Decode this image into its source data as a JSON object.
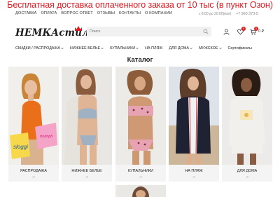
{
  "promo": {
    "text": "Бесплатная доставка оплаченного заказа от 10 тыс (в пункт Озон)"
  },
  "topbar": {
    "links": [
      "ДОСТАВКА",
      "ОПЛАТА",
      "ВОПРОС ОТВЕТ",
      "ОТЗЫВЫ",
      "КОНТАКТЫ",
      "О КОМПАНИИ"
    ],
    "hours": "с 8:00 до 20:00(мск)",
    "phone": "+7 960 373-5"
  },
  "header": {
    "logo_text": "НЕМКАстиль",
    "search_placeholder": "Поиск",
    "wishlist_count": "0",
    "cart_count": "0",
    "cart_sum": "0 ₽"
  },
  "mainnav": {
    "items": [
      "СКИДКИ / РАСПРОДАЖА",
      "НИЖНЕЕ БЕЛЬЕ",
      "КУПАЛЬНИКИ",
      "НА ПЛЯЖ",
      "ДЛЯ ДОМА",
      "МУЖСКОЕ",
      "Сертификаты"
    ]
  },
  "catalog": {
    "heading": "Каталог",
    "arrow": "→",
    "cards": [
      {
        "label": "РАСПРОДАЖА",
        "bag1": "sloggi",
        "bag2": "triumph"
      },
      {
        "label": "НИЖНЕЕ БЕЛЬЕ"
      },
      {
        "label": "КУПАЛЬНИКИ"
      },
      {
        "label": "НА ПЛЯЖ"
      },
      {
        "label": "ДЛЯ ДОМА"
      }
    ]
  },
  "colors": {
    "accent": "#e01b22",
    "card_bg": "#f4f4f4"
  },
  "icons": [
    "search-icon",
    "user-icon",
    "heart-icon",
    "cart-icon",
    "chevron-down-icon",
    "arrow-right-icon"
  ]
}
